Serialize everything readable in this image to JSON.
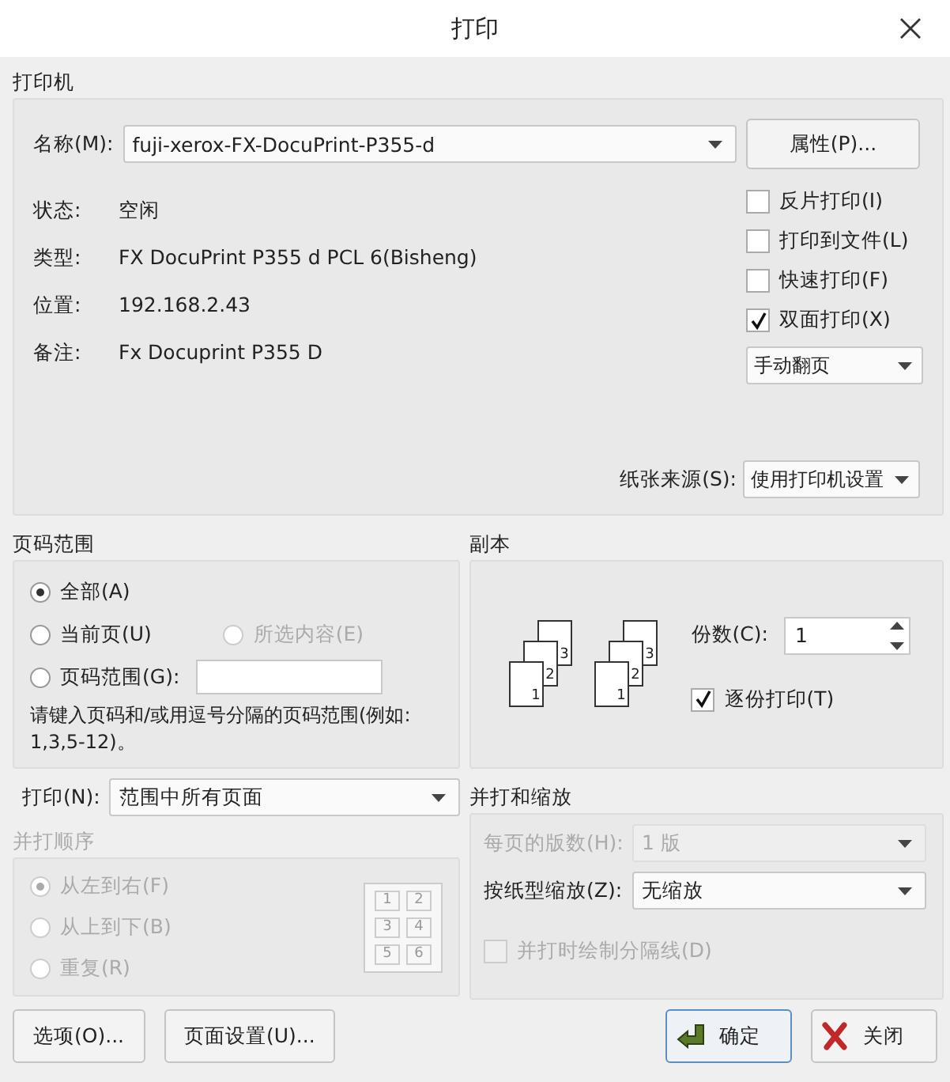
{
  "window": {
    "title": "打印"
  },
  "printer": {
    "heading": "打印机",
    "name_label": "名称(M):",
    "name_value": "fuji-xerox-FX-DocuPrint-P355-d",
    "properties_button": "属性(P)...",
    "info": [
      {
        "label": "状态:",
        "value": "空闲"
      },
      {
        "label": "类型:",
        "value": "FX DocuPrint P355 d PCL 6(Bisheng)"
      },
      {
        "label": "位置:",
        "value": "192.168.2.43"
      },
      {
        "label": "备注:",
        "value": "Fx Docuprint P355 D"
      }
    ],
    "options": [
      {
        "label": "反片打印(I)",
        "checked": false
      },
      {
        "label": "打印到文件(L)",
        "checked": false
      },
      {
        "label": "快速打印(F)",
        "checked": false
      },
      {
        "label": "双面打印(X)",
        "checked": true
      }
    ],
    "duplex_mode": "手动翻页",
    "paper_source_label": "纸张来源(S):",
    "paper_source": "使用打印机设置"
  },
  "page_range": {
    "heading": "页码范围",
    "choices": [
      {
        "label": "全部(A)",
        "selected": true,
        "disabled": false
      },
      {
        "label": "当前页(U)",
        "selected": false,
        "disabled": false
      },
      {
        "label": "所选内容(E)",
        "selected": false,
        "disabled": true
      },
      {
        "label": "页码范围(G):",
        "selected": false,
        "disabled": false
      }
    ],
    "hint": "请键入页码和/或用逗号分隔的页码范围(例如: 1,3,5-12)。",
    "print_label": "打印(N):",
    "print_value": "范围中所有页面"
  },
  "copies": {
    "heading": "副本",
    "count_label": "份数(C):",
    "count": "1",
    "collate_label": "逐份打印(T)",
    "collate": true,
    "stacks": [
      [
        "1",
        "2",
        "3"
      ],
      [
        "1",
        "2",
        "3"
      ]
    ]
  },
  "order": {
    "heading": "并打顺序",
    "disabled": true,
    "choices": [
      {
        "label": "从左到右(F)",
        "selected": true
      },
      {
        "label": "从上到下(B)",
        "selected": false
      },
      {
        "label": "重复(R)",
        "selected": false
      }
    ],
    "grid": [
      "1",
      "2",
      "3",
      "4",
      "5",
      "6"
    ]
  },
  "scaling": {
    "heading": "并打和缩放",
    "per_page_label": "每页的版数(H):",
    "per_page": "1 版",
    "per_page_disabled": true,
    "scale_label": "按纸型缩放(Z):",
    "scale": "无缩放",
    "separator_label": "并打时绘制分隔线(D)",
    "separator_checked": false,
    "separator_disabled": true
  },
  "buttons": [
    {
      "label": "选项(O)...",
      "kind": "plain"
    },
    {
      "label": "页面设置(U)...",
      "kind": "plain"
    },
    {
      "label": "确定",
      "kind": "ok"
    },
    {
      "label": "关闭",
      "kind": "close"
    }
  ]
}
